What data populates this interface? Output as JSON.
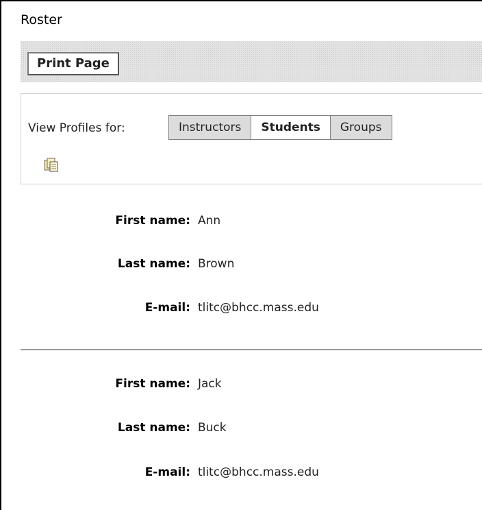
{
  "page": {
    "title": "Roster"
  },
  "toolbar": {
    "print_label": "Print Page"
  },
  "profiles": {
    "view_label": "View Profiles for:",
    "tabs": [
      {
        "label": "Instructors",
        "active": false
      },
      {
        "label": "Students",
        "active": true
      },
      {
        "label": "Groups",
        "active": false
      }
    ],
    "copy_icon": "copy-icon"
  },
  "field_labels": {
    "first_name": "First name:",
    "last_name": "Last name:",
    "email": "E-mail:"
  },
  "roster": [
    {
      "first_name": "Ann",
      "last_name": "Brown",
      "email": "tlitc@bhcc.mass.edu"
    },
    {
      "first_name": "Jack",
      "last_name": "Buck",
      "email": "tlitc@bhcc.mass.edu"
    }
  ]
}
